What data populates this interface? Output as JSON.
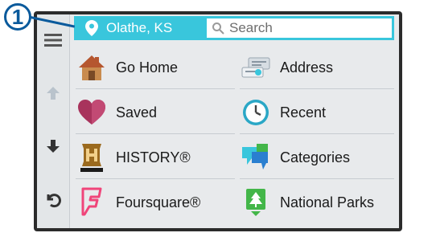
{
  "callout": {
    "number": "1"
  },
  "header": {
    "location": "Olathe, KS",
    "search_placeholder": "Search"
  },
  "sidebar": {
    "buttons": [
      "menu",
      "scroll-up",
      "scroll-down",
      "back"
    ]
  },
  "menu": [
    {
      "label": "Go Home",
      "icon": "house-icon"
    },
    {
      "label": "Address",
      "icon": "address-card-icon"
    },
    {
      "label": "Saved",
      "icon": "heart-icon"
    },
    {
      "label": "Recent",
      "icon": "clock-icon"
    },
    {
      "label": "HISTORY®",
      "icon": "history-logo-icon"
    },
    {
      "label": "Categories",
      "icon": "categories-icon"
    },
    {
      "label": "Foursquare®",
      "icon": "foursquare-icon"
    },
    {
      "label": "National Parks",
      "icon": "national-parks-icon"
    }
  ],
  "colors": {
    "accent": "#39c6dc",
    "callout": "#0a5a9c",
    "bezel": "#2b2b2b"
  }
}
